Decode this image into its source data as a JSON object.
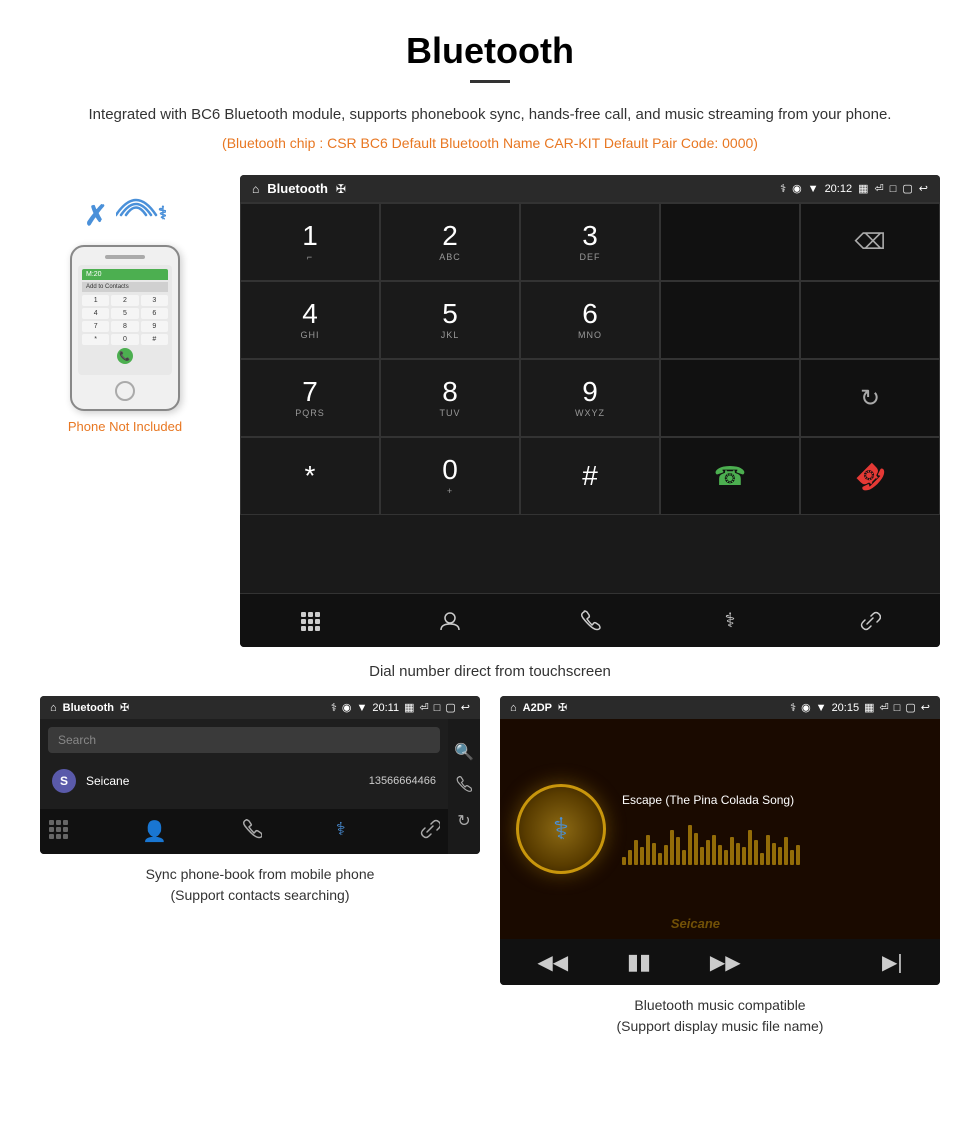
{
  "page": {
    "title": "Bluetooth",
    "description": "Integrated with BC6 Bluetooth module, supports phonebook sync, hands-free call, and music streaming from your phone.",
    "specs": "(Bluetooth chip : CSR BC6    Default Bluetooth Name CAR-KIT    Default Pair Code: 0000)"
  },
  "phone_illustration": {
    "not_included_text": "Phone Not Included",
    "screen_header": "M:20",
    "add_contacts": "Add to Contacts",
    "dialpad": [
      "1",
      "2",
      "3",
      "4",
      "5",
      "6",
      "7",
      "8",
      "9",
      "*",
      "0",
      "#"
    ]
  },
  "dialer_screen": {
    "title": "Bluetooth",
    "time": "20:12",
    "keys": [
      {
        "num": "1",
        "sub": "⌐"
      },
      {
        "num": "2",
        "sub": "ABC"
      },
      {
        "num": "3",
        "sub": "DEF"
      },
      {
        "num": "",
        "sub": ""
      },
      {
        "num": "⌫",
        "sub": ""
      },
      {
        "num": "4",
        "sub": "GHI"
      },
      {
        "num": "5",
        "sub": "JKL"
      },
      {
        "num": "6",
        "sub": "MNO"
      },
      {
        "num": "",
        "sub": ""
      },
      {
        "num": "",
        "sub": ""
      },
      {
        "num": "7",
        "sub": "PQRS"
      },
      {
        "num": "8",
        "sub": "TUV"
      },
      {
        "num": "9",
        "sub": "WXYZ"
      },
      {
        "num": "",
        "sub": ""
      },
      {
        "num": "↻",
        "sub": ""
      },
      {
        "num": "*",
        "sub": ""
      },
      {
        "num": "0",
        "sub": "+"
      },
      {
        "num": "#",
        "sub": ""
      },
      {
        "num": "📞",
        "sub": ""
      },
      {
        "num": "📵",
        "sub": ""
      }
    ],
    "nav_icons": [
      "⊞",
      "👤",
      "📞",
      "✱",
      "🔗"
    ],
    "caption": "Dial number direct from touchscreen"
  },
  "phonebook_screen": {
    "title": "Bluetooth",
    "time": "20:11",
    "search_placeholder": "Search",
    "contacts": [
      {
        "letter": "S",
        "name": "Seicane",
        "number": "13566664466"
      }
    ],
    "caption_line1": "Sync phone-book from mobile phone",
    "caption_line2": "(Support contacts searching)"
  },
  "music_screen": {
    "title": "A2DP",
    "time": "20:15",
    "song_title": "Escape (The Pina Colada Song)",
    "spectrum_bars": [
      8,
      15,
      25,
      18,
      30,
      22,
      12,
      20,
      35,
      28,
      15,
      40,
      32,
      18,
      25,
      30,
      20,
      15,
      28,
      22,
      18,
      35,
      25,
      12,
      30,
      22,
      18,
      28,
      15,
      20
    ],
    "caption_line1": "Bluetooth music compatible",
    "caption_line2": "(Support display music file name)"
  },
  "watermark": "Seicane"
}
